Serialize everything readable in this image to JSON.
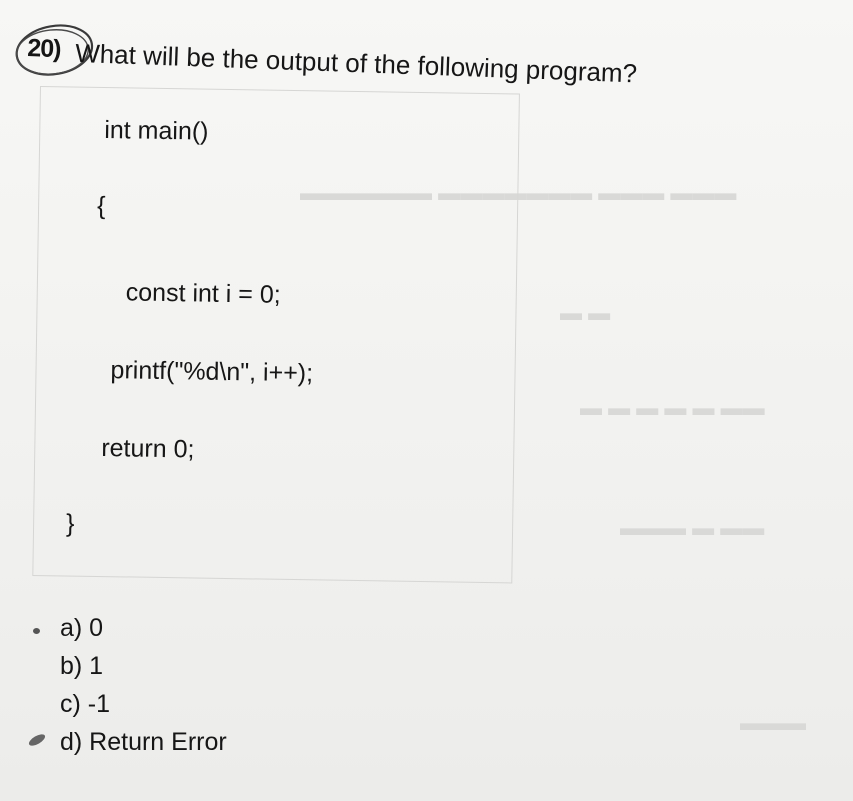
{
  "question": {
    "number": "20)",
    "text": "What will be the output of the following program?"
  },
  "code": {
    "lines": [
      "int main()",
      "{",
      "const int i = 0;",
      "printf(\"%d\\n\", i++);",
      "return 0;",
      "}"
    ]
  },
  "options": [
    "a) 0",
    "b) 1",
    "c) -1",
    "d) Return Error"
  ]
}
